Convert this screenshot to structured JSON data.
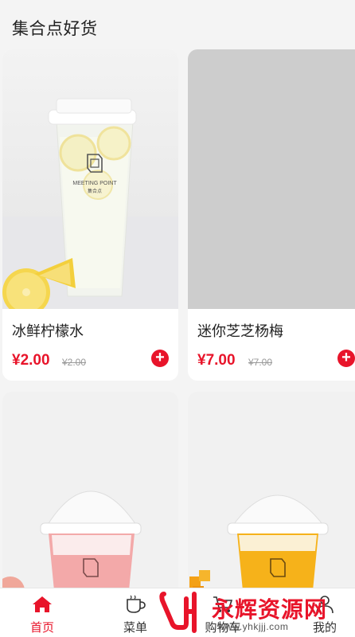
{
  "header": {
    "title": "集合点好货"
  },
  "products": [
    {
      "name": "冰鲜柠檬水",
      "price": "¥2.00",
      "old_price": "¥2.00",
      "image": "lemon-tea-cup",
      "has_image": true
    },
    {
      "name": "迷你芝芝杨梅",
      "price": "¥7.00",
      "old_price": "¥7.00",
      "image": "placeholder-gray",
      "has_image": false
    },
    {
      "name": "",
      "image": "strawberry-milk-cup",
      "has_image": true
    },
    {
      "name": "",
      "image": "mango-cup",
      "has_image": true
    }
  ],
  "cup_brand": {
    "line1": "MEETING POINT",
    "line2": "集合点"
  },
  "tabbar": {
    "items": [
      {
        "label": "首页",
        "icon": "home-icon",
        "active": true
      },
      {
        "label": "菜单",
        "icon": "cup-icon",
        "active": false
      },
      {
        "label": "购物车",
        "icon": "cart-icon",
        "active": false
      },
      {
        "label": "我的",
        "icon": "user-icon",
        "active": false
      }
    ]
  },
  "watermark": {
    "text": "永辉资源网",
    "url": "www.yhkjjj.com"
  },
  "colors": {
    "accent": "#e8142a",
    "background": "#f4f4f4",
    "placeholder": "#cdcdcd"
  }
}
